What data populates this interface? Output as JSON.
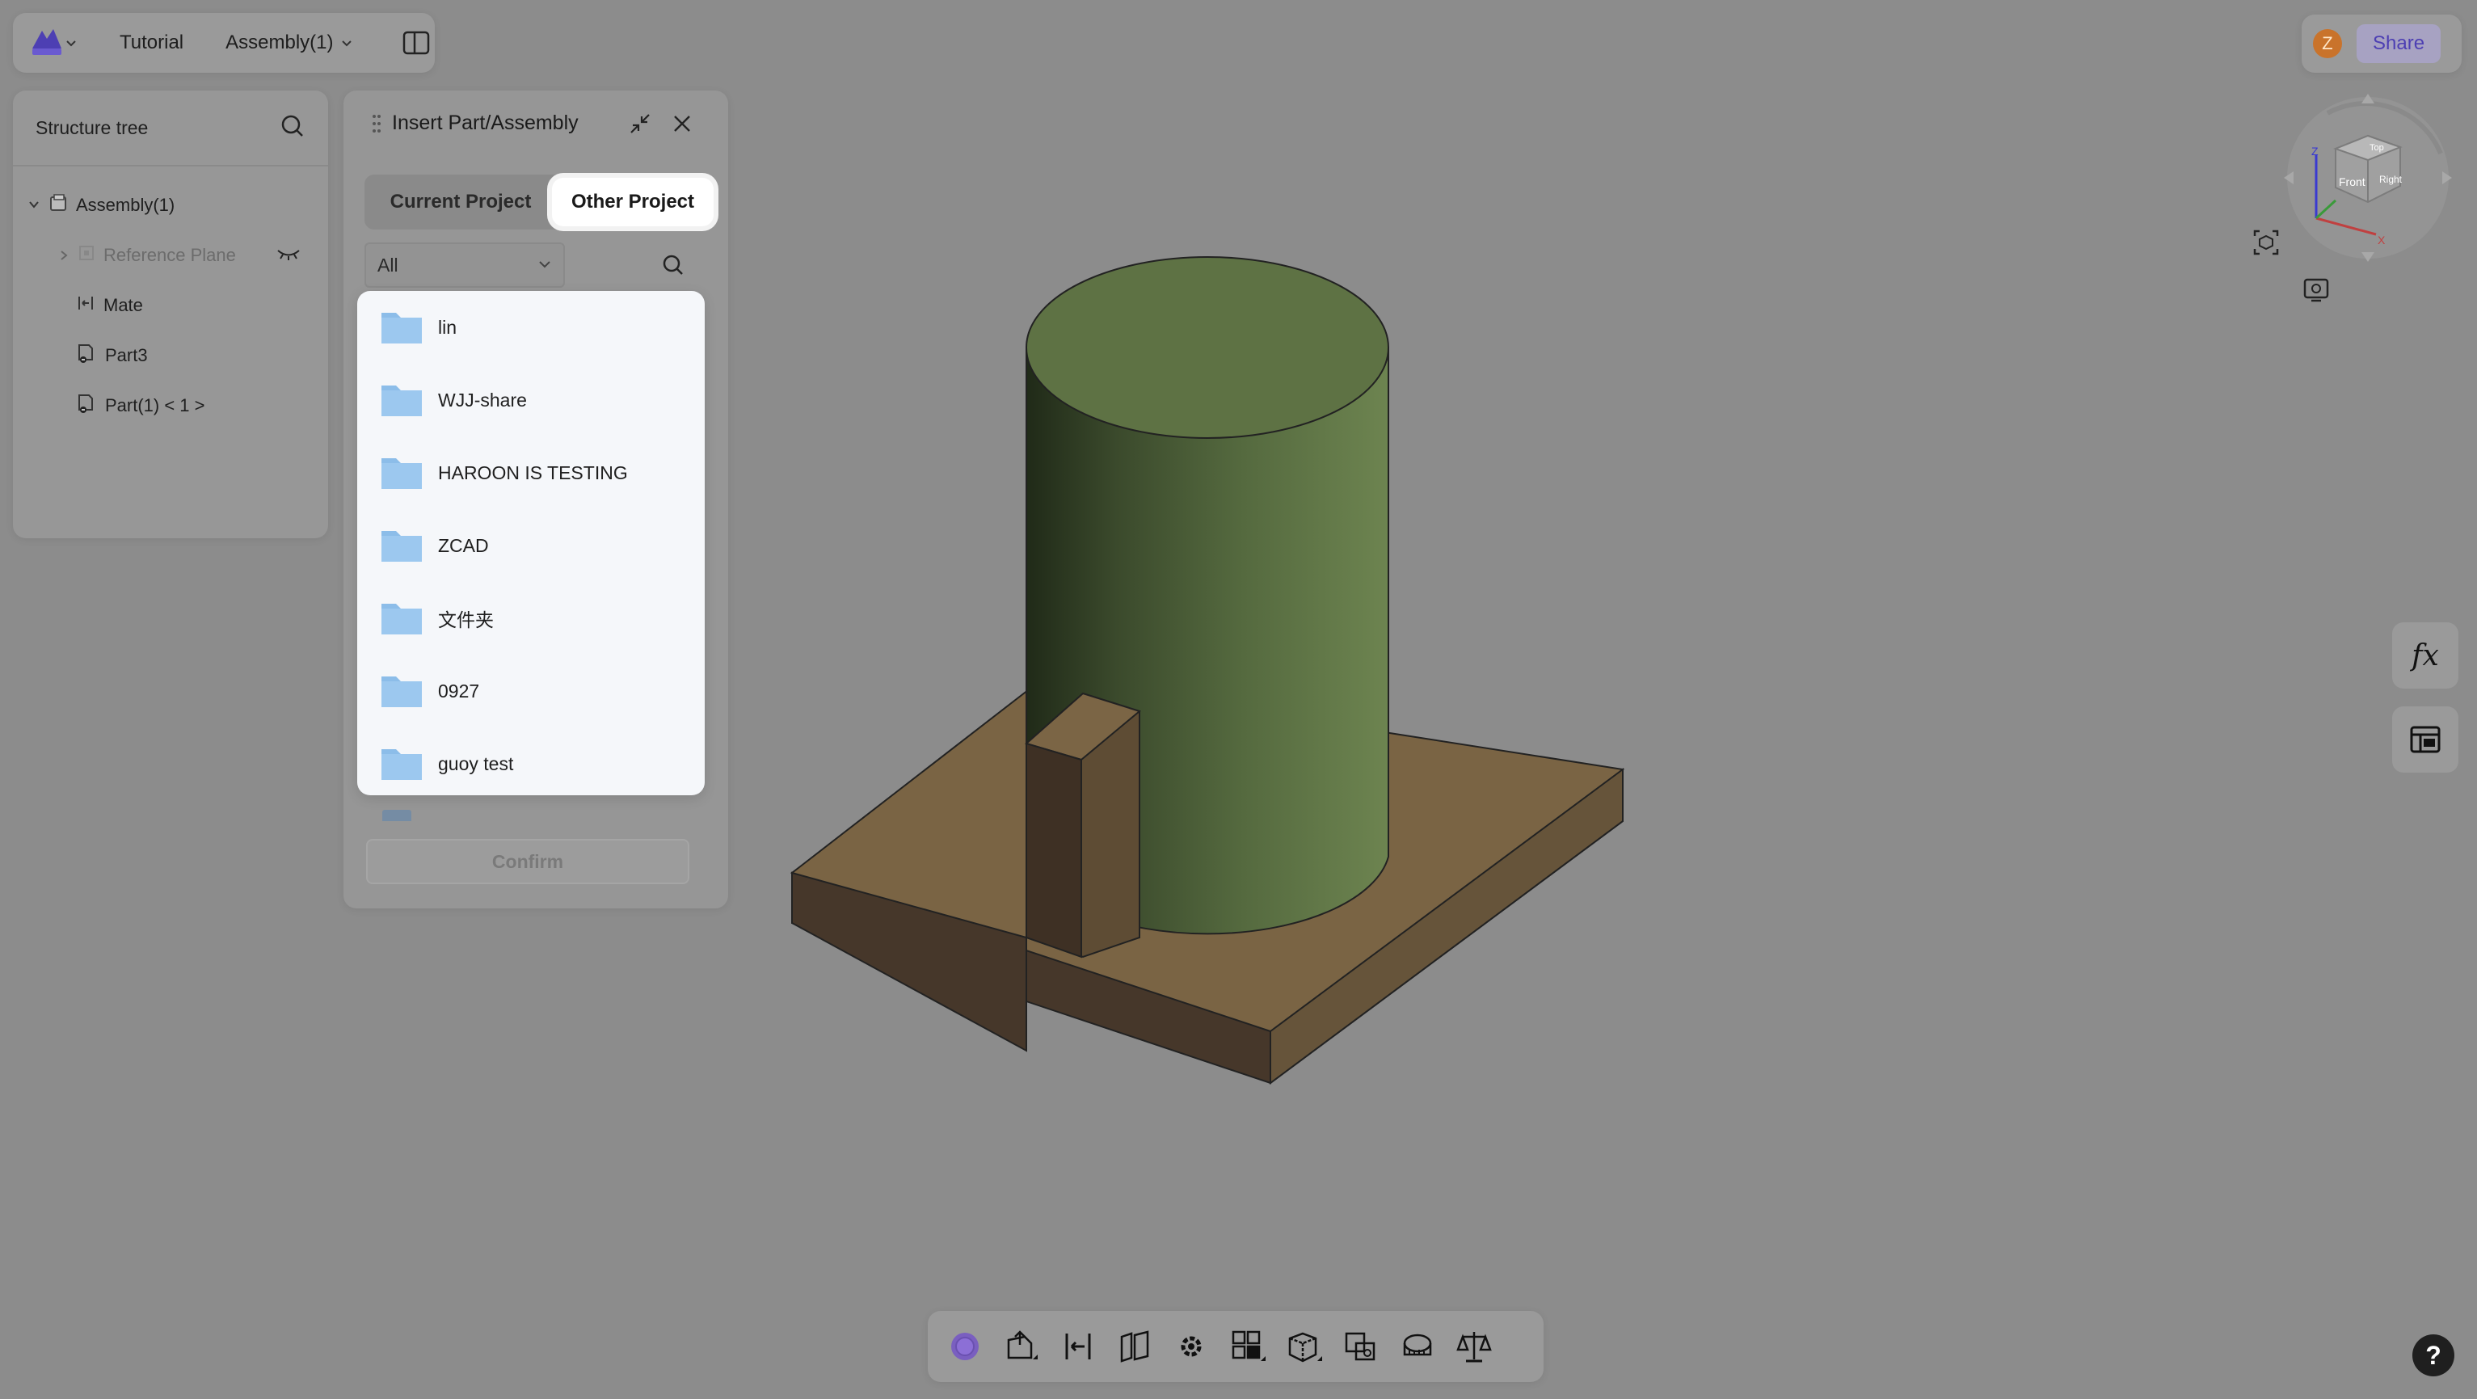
{
  "topbar": {
    "project": "Tutorial",
    "document": "Assembly(1)",
    "logo_icon": "app-logo-icon",
    "layout_icon": "panel-layout-icon"
  },
  "user": {
    "avatar_initial": "Z",
    "share_label": "Share",
    "avatar_color": "#c9732b"
  },
  "structure_tree": {
    "title": "Structure tree",
    "items": [
      {
        "label": "Assembly(1)",
        "icon": "assembly-icon"
      },
      {
        "label": "Reference Plane",
        "icon": "plane-icon"
      },
      {
        "label": "Mate",
        "icon": "mate-icon"
      },
      {
        "label": "Part3",
        "icon": "part-icon"
      },
      {
        "label": "Part(1) < 1 >",
        "icon": "part-icon"
      }
    ]
  },
  "insert_dialog": {
    "title": "Insert Part/Assembly",
    "tabs": [
      {
        "label": "Current Project",
        "active": false
      },
      {
        "label": "Other Project",
        "active": true
      }
    ],
    "filter": {
      "value": "All"
    },
    "folders": [
      {
        "name": "lin"
      },
      {
        "name": "WJJ-share"
      },
      {
        "name": "HAROON IS TESTING"
      },
      {
        "name": "ZCAD"
      },
      {
        "name": "文件夹"
      },
      {
        "name": "0927"
      },
      {
        "name": "guoy test"
      }
    ],
    "confirm_label": "Confirm"
  },
  "viewcube": {
    "faces": [
      "Top",
      "Front",
      "Right"
    ],
    "axes": [
      "Z",
      "X"
    ]
  },
  "side_tools": {
    "fx_label": "fx"
  },
  "toolbar": {
    "tools": [
      "sketch-circle-icon",
      "extrude-icon",
      "mate-icon",
      "plane-icon",
      "settings-gear-icon",
      "pattern-icon",
      "box-view-icon",
      "transform-icon",
      "measure-icon",
      "balance-icon"
    ]
  },
  "help_label": "?"
}
